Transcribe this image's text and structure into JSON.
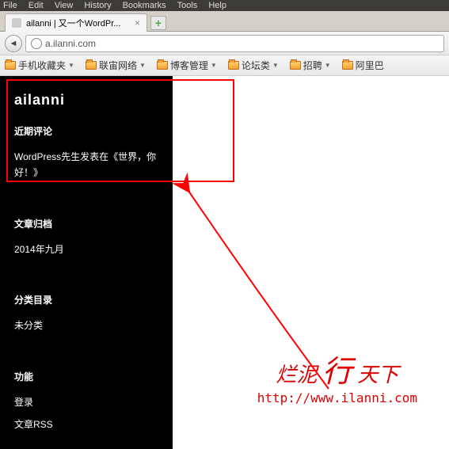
{
  "menu": {
    "file": "File",
    "edit": "Edit",
    "view": "View",
    "history": "History",
    "bookmarks": "Bookmarks",
    "tools": "Tools",
    "help": "Help"
  },
  "tab": {
    "title": "ailanni | 又一个WordPr...",
    "close": "×",
    "new": "+"
  },
  "url": {
    "text": "a.ilanni.com",
    "back": "◄"
  },
  "bookmarks": [
    {
      "label": "手机收藏夹"
    },
    {
      "label": "联宙网络"
    },
    {
      "label": "博客管理"
    },
    {
      "label": "论坛类"
    },
    {
      "label": "招聘"
    },
    {
      "label": "阿里巴"
    }
  ],
  "sidebar": {
    "site_title": "ailanni",
    "recent_comments": {
      "title": "近期评论",
      "item_prefix": "WordPress先生",
      "item_mid": "发表在",
      "item_link": "《世界，你好！》"
    },
    "archives": {
      "title": "文章归档",
      "item": "2014年九月"
    },
    "categories": {
      "title": "分类目录",
      "item": "未分类"
    },
    "meta": {
      "title": "功能",
      "login": "登录",
      "rss": "文章RSS"
    }
  },
  "watermark": {
    "cn1": "烂泥",
    "cn2": "行",
    "cn3": "天下",
    "url": "http://www.ilanni.com"
  }
}
